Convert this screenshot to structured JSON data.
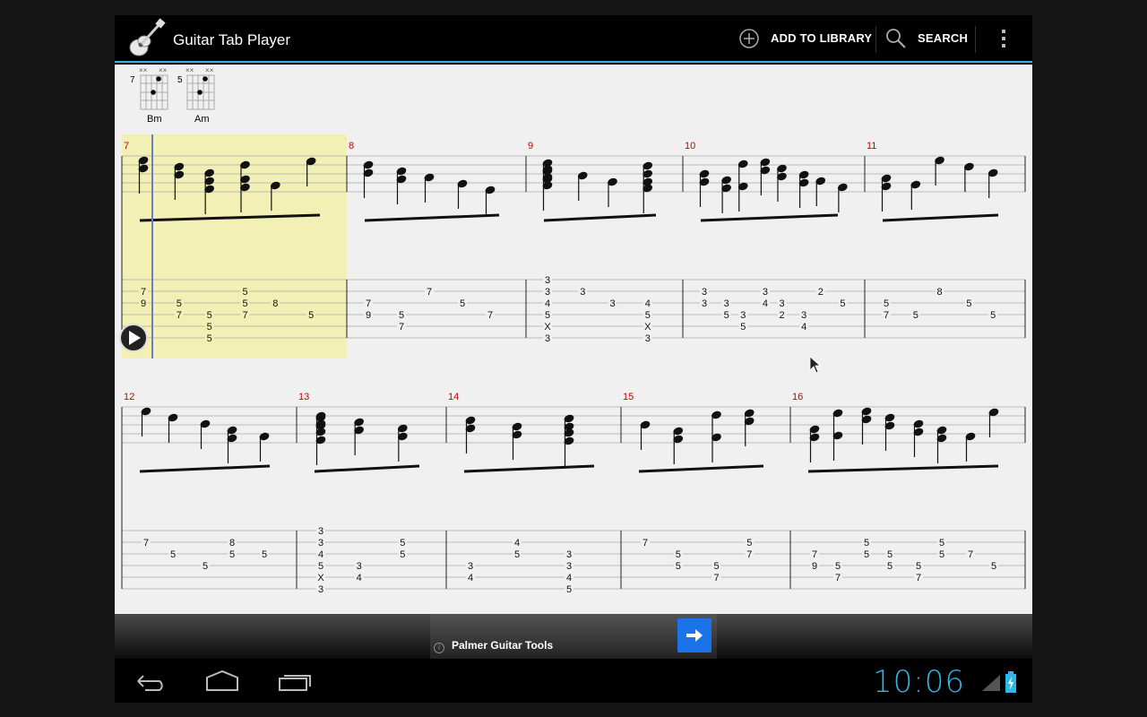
{
  "app": {
    "title": "Guitar Tab Player"
  },
  "actionbar": {
    "add_label": "ADD TO LIBRARY",
    "search_label": "SEARCH",
    "icons": {
      "add": "add-circle-icon",
      "search": "search-icon",
      "overflow": "overflow-menu-icon",
      "app": "guitar-icon"
    }
  },
  "chords": [
    {
      "name": "Bm",
      "fret": "7"
    },
    {
      "name": "Am",
      "fret": "5"
    }
  ],
  "rows": [
    {
      "measures": [
        {
          "number": "7",
          "notes": [
            [
              "7",
              "9"
            ],
            [
              "5",
              "7"
            ],
            [
              "5",
              "5",
              "5"
            ],
            [
              "5",
              "5",
              "7"
            ],
            [
              "8"
            ],
            [
              "5"
            ]
          ]
        },
        {
          "number": "8",
          "notes": [
            [
              "7",
              "9"
            ],
            [
              "5",
              "7"
            ],
            [
              "7"
            ],
            [
              "5"
            ],
            [
              "7"
            ]
          ]
        },
        {
          "number": "9",
          "notes": [
            [
              "3",
              "3",
              "4",
              "5",
              "X",
              "3"
            ],
            [
              "3"
            ],
            [
              "3"
            ],
            [
              "4",
              "5",
              "X",
              "3"
            ]
          ]
        },
        {
          "number": "10",
          "notes": [
            [
              "3",
              "3"
            ],
            [
              "3",
              "5"
            ],
            [
              "3",
              "5"
            ],
            [
              "3",
              "4"
            ],
            [
              "3",
              "2"
            ],
            [
              "3",
              "4"
            ],
            [
              "2"
            ],
            [
              "5"
            ]
          ]
        },
        {
          "number": "11",
          "notes": [
            [
              "5",
              "7"
            ],
            [
              "5"
            ],
            [
              "8"
            ],
            [
              "5"
            ],
            [
              "5"
            ]
          ]
        }
      ]
    },
    {
      "measures": [
        {
          "number": "12",
          "notes": [
            [
              "7"
            ],
            [
              "5"
            ],
            [
              "5"
            ],
            [
              "8",
              "5"
            ],
            [
              "5"
            ]
          ]
        },
        {
          "number": "13",
          "notes": [
            [
              "3",
              "3",
              "4",
              "5",
              "X",
              "3"
            ],
            [
              "3",
              "4"
            ],
            [
              "5",
              "5"
            ]
          ]
        },
        {
          "number": "14",
          "notes": [
            [
              "3",
              "4"
            ],
            [
              "4",
              "5"
            ],
            [
              "3",
              "3",
              "4",
              "5"
            ]
          ]
        },
        {
          "number": "15",
          "notes": [
            [
              "7"
            ],
            [
              "5",
              "5"
            ],
            [
              "5",
              "7"
            ],
            [
              "5",
              "7"
            ]
          ]
        },
        {
          "number": "16",
          "notes": [
            [
              "7",
              "9"
            ],
            [
              "5",
              "7"
            ],
            [
              "5",
              "5"
            ],
            [
              "5",
              "5"
            ],
            [
              "5",
              "7"
            ],
            [
              "5",
              "5"
            ],
            [
              "7"
            ],
            [
              "5"
            ]
          ]
        }
      ]
    }
  ],
  "ad": {
    "text": "Palmer Guitar Tools",
    "info_icon": "info-icon",
    "go_icon": "arrow-right-icon"
  },
  "status": {
    "time": "10:06"
  },
  "colors": {
    "accent": "#33b5e5",
    "highlight": "#f3f0b5",
    "measure_number": "#cc0000",
    "cursor": "#6a7fc4"
  }
}
